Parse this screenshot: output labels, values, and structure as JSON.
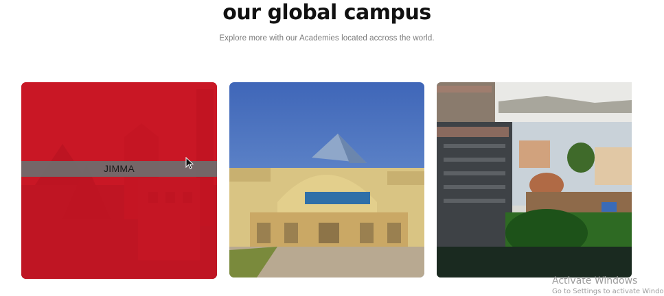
{
  "section": {
    "title": "our global campus",
    "subtitle": "Explore more with our Academies located accross the world."
  },
  "campuses": [
    {
      "caption": "JIMMA",
      "state": "hovered"
    },
    {
      "caption": ""
    },
    {
      "caption": ""
    }
  ],
  "colors": {
    "hover_overlay": "#d61424",
    "caption_band": "#6e6e6e"
  },
  "os_watermark": {
    "line1": "Activate Windows",
    "line2": "Go to Settings to activate Windows."
  }
}
